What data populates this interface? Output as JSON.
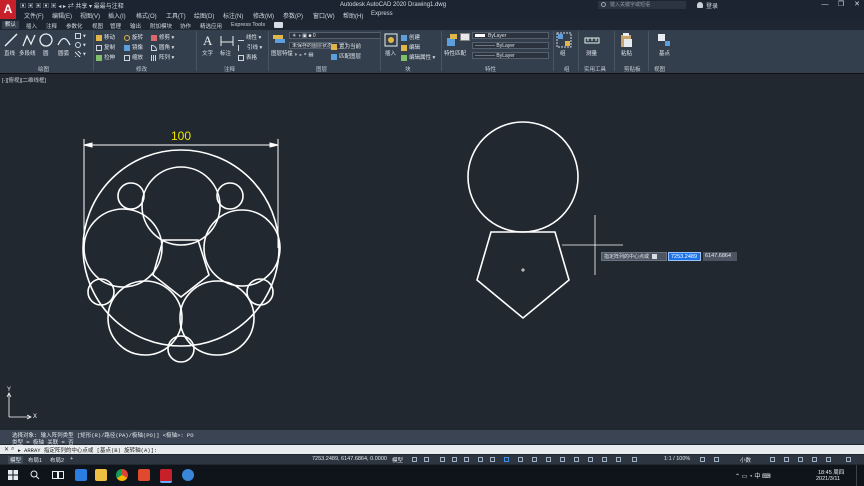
{
  "titlebar": {
    "app_logo": "A",
    "quick_access": "▣ ▣ ▣ ▣ ▣ ◂ ▸  ⇄ 共享  ▾ 最最与注释",
    "title": "Autodesk AutoCAD 2020    Drawing1.dwg",
    "search_placeholder": "键入关键字或短语",
    "login": "登录",
    "minimize": "—",
    "restore": "❐",
    "close": "✕"
  },
  "menubar": [
    "文件(F)",
    "编辑(E)",
    "视图(V)",
    "插入(I)",
    "格式(O)",
    "工具(T)",
    "绘图(D)",
    "标注(N)",
    "修改(M)",
    "参数(P)",
    "窗口(W)",
    "帮助(H)",
    "Express"
  ],
  "tabs": [
    "默认",
    "插入",
    "注释",
    "参数化",
    "视图",
    "管理",
    "输出",
    "附加模块",
    "协作",
    "精选应用",
    "Express Tools"
  ],
  "ribbon": {
    "draw": {
      "line": "直线",
      "polyline": "多段线",
      "circle": "圆",
      "arc": "圆弧",
      "panel": "绘图"
    },
    "modify": {
      "move": "移动",
      "rotate": "旋转",
      "trim": "修剪",
      "copy": "复制",
      "mirror": "镜像",
      "fillet": "圆角",
      "stretch": "拉伸",
      "scale": "缩放",
      "array": "阵列",
      "panel": "修改"
    },
    "annotation": {
      "text": "文字",
      "dimension": "标注",
      "linear": "线性",
      "leader": "引线",
      "table": "表格",
      "panel": "注释"
    },
    "layers": {
      "layer_props": "图层特性",
      "current_layer": "0",
      "layer_state": "未保存的图层状态",
      "make_current": "置为当前",
      "match_layer": "匹配图层",
      "panel": "图层"
    },
    "block": {
      "insert": "插入",
      "create": "创建",
      "edit": "编辑",
      "edit_attr": "编辑属性",
      "panel": "块"
    },
    "properties": {
      "match": "特性匹配",
      "color": "ByLayer",
      "linetype": "ByLayer",
      "lineweight": "ByLayer",
      "panel": "特性"
    },
    "groups": {
      "group": "组",
      "panel": "组"
    },
    "utilities": {
      "measure": "测量",
      "panel": "实用工具"
    },
    "clipboard": {
      "paste": "粘贴",
      "panel": "剪贴板"
    },
    "view": {
      "base": "基点",
      "panel": "视图"
    }
  },
  "viewport_label": "[-][俯视][二维线框]",
  "drawing": {
    "dimension_text": "100",
    "dimension_color": "#f2e600"
  },
  "cursor_prompt": {
    "label": "指定阵列的中心点或",
    "x": "7253.2489",
    "y": "6147.6864"
  },
  "command": {
    "history1": "选择对象:  输入阵列类型 [矩形(R)/路径(PA)/极轴(PO)] <极轴>: PO",
    "history2": "类型 = 极轴  关联 = 否",
    "input": "▸ ARRAY 指定阵列的中心点或 [基点(B) 旋转轴(A)]:"
  },
  "statusbar": {
    "model_tab": "模型",
    "layout1": "布局1",
    "layout2": "布局2",
    "add": "+",
    "coords": "7253.2489, 6147.6864, 0.0000",
    "model": "模型",
    "scale": "1:1 / 100%",
    "units": "小数"
  },
  "taskbar": {
    "time": "18:45 周四",
    "date": "2021/3/11"
  },
  "colors": {
    "accent": "#1a73e8",
    "geometry": "#ffffff",
    "dimension": "#f2e600",
    "background": "#212830"
  }
}
